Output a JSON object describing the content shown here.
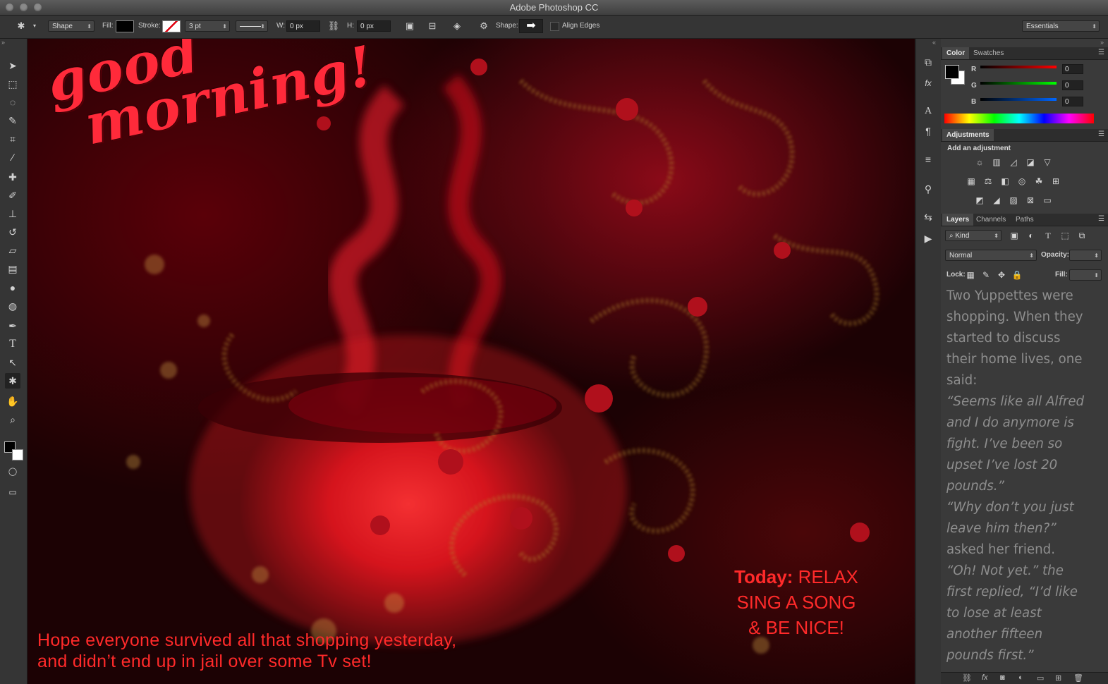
{
  "app": {
    "title": "Adobe Photoshop CC"
  },
  "options": {
    "tool_mode": "Shape",
    "fill_label": "Fill:",
    "stroke_label": "Stroke:",
    "stroke_width": "3 pt",
    "w_label": "W:",
    "w_value": "0 px",
    "h_label": "H:",
    "h_value": "0 px",
    "shape_label": "Shape:",
    "align_edges": "Align Edges",
    "workspace": "Essentials"
  },
  "tools": [
    "move-tool",
    "marquee-tool",
    "lasso-tool",
    "quick-select-tool",
    "crop-tool",
    "eyedropper-tool",
    "healing-brush-tool",
    "brush-tool",
    "clone-stamp-tool",
    "history-brush-tool",
    "eraser-tool",
    "gradient-tool",
    "blur-tool",
    "dodge-tool",
    "pen-tool",
    "type-tool",
    "path-select-tool",
    "custom-shape-tool",
    "hand-tool",
    "zoom-tool"
  ],
  "canvas": {
    "greeting_line1": "good",
    "greeting_line2": "morning!",
    "today_bold": "Today:",
    "today_rest": " RELAX",
    "today_line2": "SING A SONG",
    "today_line3": "& BE NICE!",
    "hope_line1": "Hope everyone survived all that shopping yesterday,",
    "hope_line2": "and didn’t end up in jail over some Tv set!"
  },
  "color_panel": {
    "tabs": [
      "Color",
      "Swatches"
    ],
    "r_label": "R",
    "g_label": "G",
    "b_label": "B",
    "r": "0",
    "g": "0",
    "b": "0"
  },
  "adjustments_panel": {
    "tab": "Adjustments",
    "subtitle": "Add an adjustment"
  },
  "layers_panel": {
    "tabs": [
      "Layers",
      "Channels",
      "Paths"
    ],
    "kind": "Kind",
    "blend_mode": "Normal",
    "opacity_label": "Opacity:",
    "lock_label": "Lock:",
    "fill_label": "Fill:"
  },
  "story": [
    {
      "text": "Two Yuppettes were",
      "italic": false
    },
    {
      "text": "shopping. When they",
      "italic": false
    },
    {
      "text": "started to discuss",
      "italic": false
    },
    {
      "text": "their home lives, one",
      "italic": false
    },
    {
      "text": "said:",
      "italic": false
    },
    {
      "text": "“Seems like all Alfred",
      "italic": true
    },
    {
      "text": "and I do anymore is",
      "italic": true
    },
    {
      "text": "fight. I’ve been so",
      "italic": true
    },
    {
      "text": "upset I’ve lost 20",
      "italic": true
    },
    {
      "text": "pounds.”",
      "italic": true
    },
    {
      "text": "“Why don’t you just",
      "italic": true
    },
    {
      "text": "leave him then?”",
      "italic": true
    },
    {
      "text": "asked her friend.",
      "italic": false
    },
    {
      "text": "“Oh! Not yet.” the",
      "italic": true
    },
    {
      "text": "first replied, “I’d like",
      "italic": true
    },
    {
      "text": "to lose at least",
      "italic": true
    },
    {
      "text": "another fifteen",
      "italic": true
    },
    {
      "text": "pounds first.”",
      "italic": true
    }
  ],
  "colors": {
    "accent_red": "#ff2a2a",
    "panel_bg": "#3a3a3a",
    "chrome": "#353535"
  }
}
